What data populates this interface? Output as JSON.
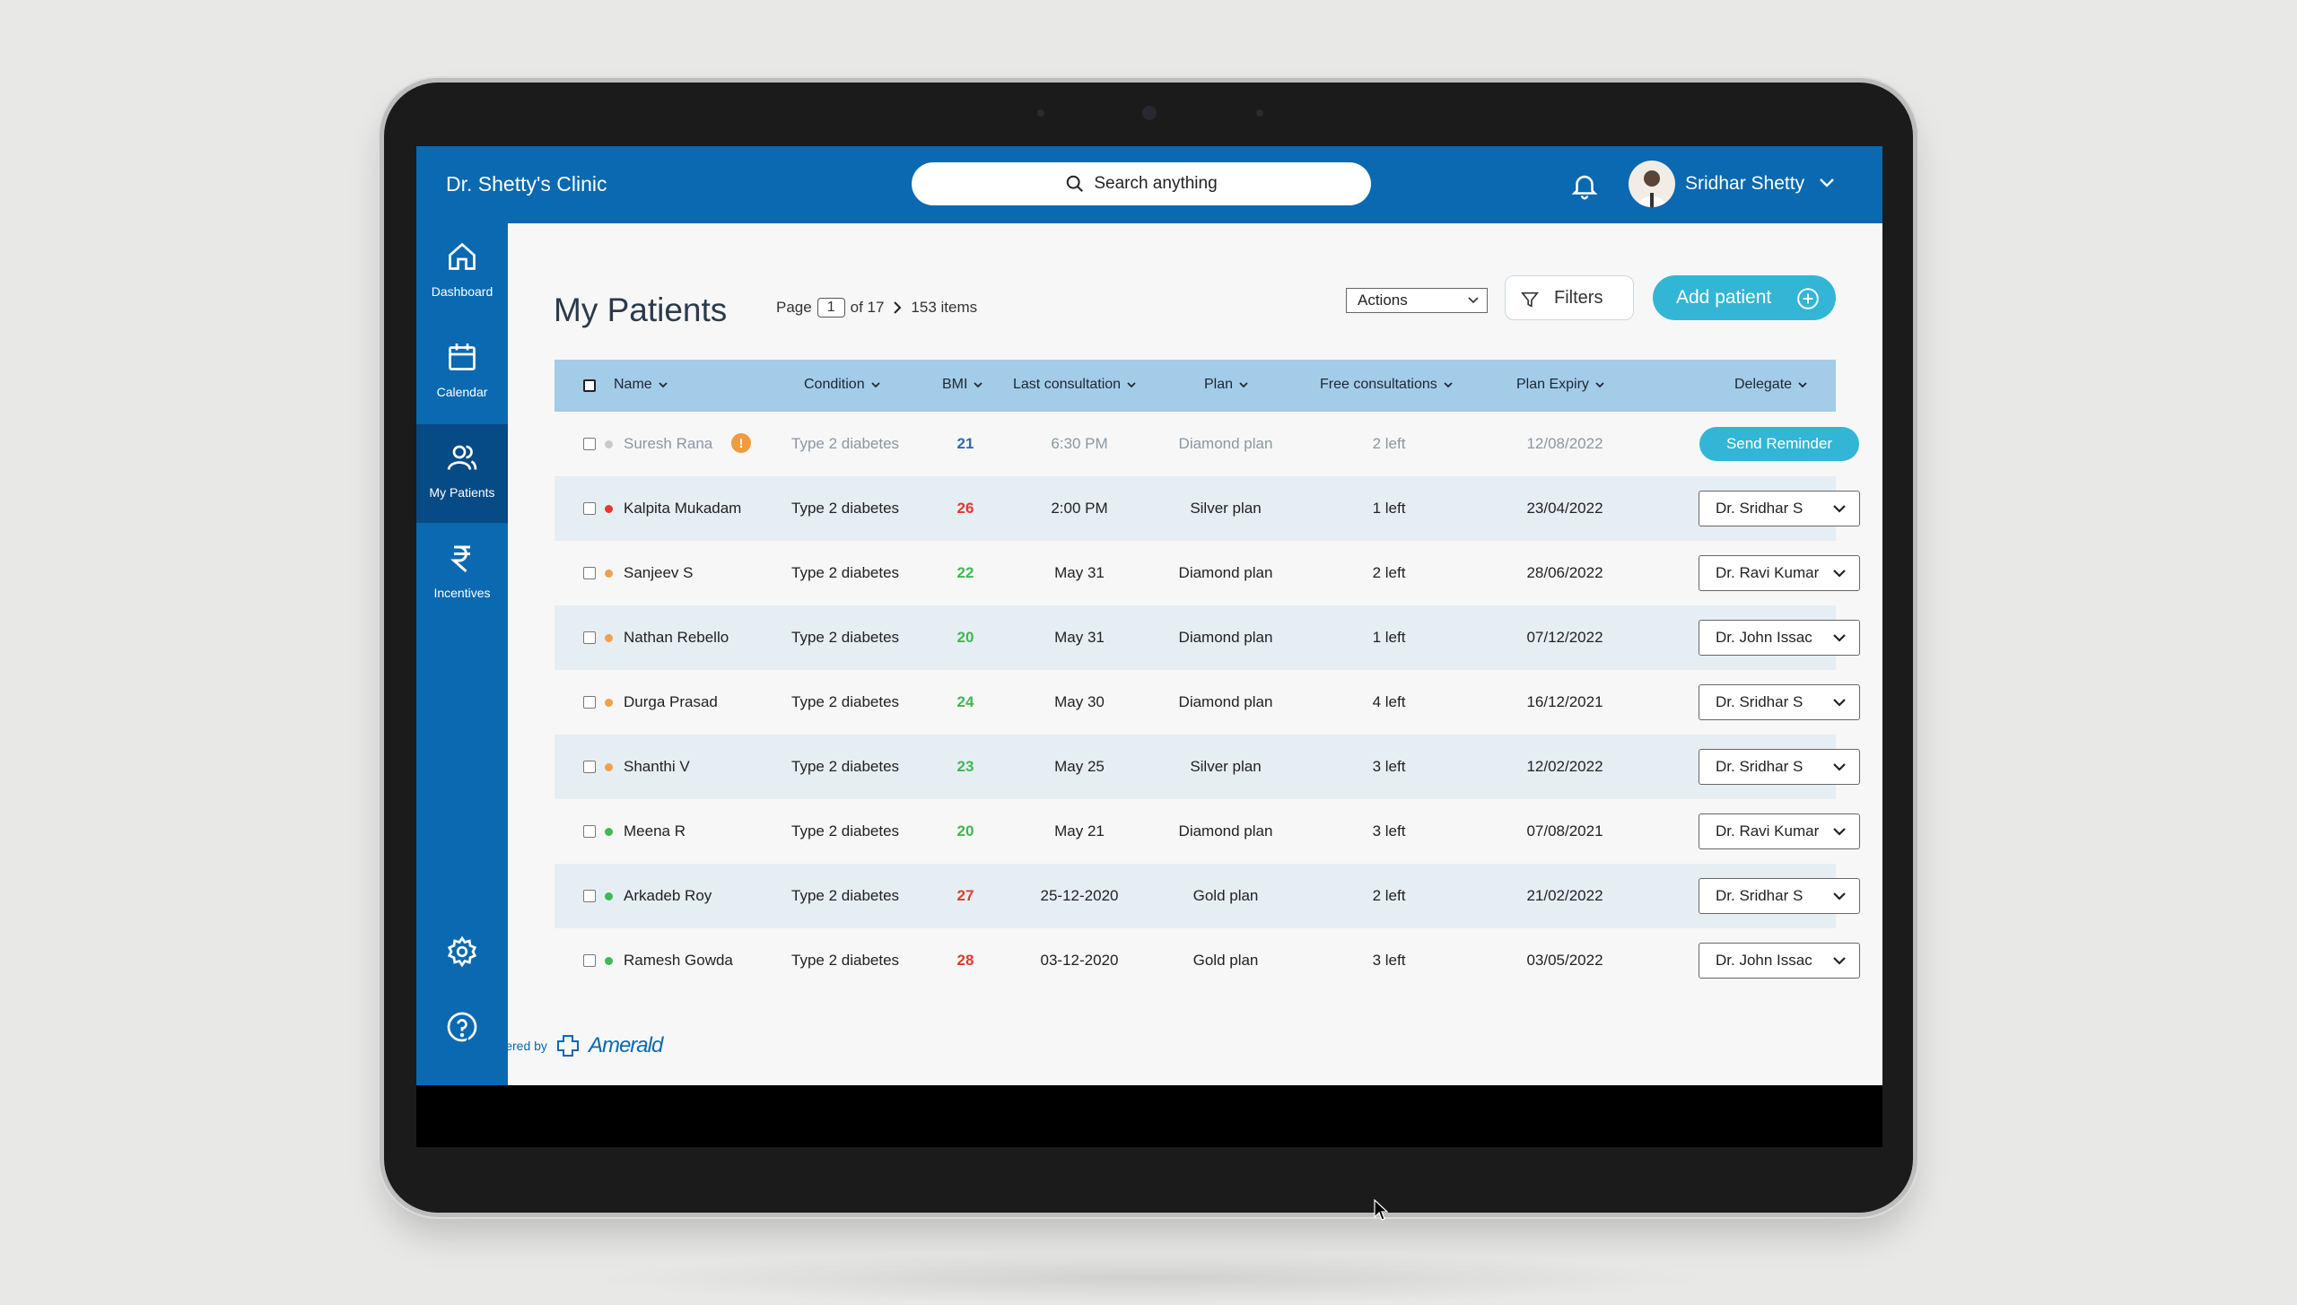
{
  "header": {
    "clinic_name": "Dr. Shetty's Clinic",
    "search_placeholder": "Search anything",
    "user_name": "Sridhar Shetty"
  },
  "sidebar": {
    "items": [
      {
        "label": "Dashboard",
        "icon": "home-icon"
      },
      {
        "label": "Calendar",
        "icon": "calendar-icon"
      },
      {
        "label": "My Patients",
        "icon": "users-icon",
        "active": true
      },
      {
        "label": "Incentives",
        "icon": "rupee-icon"
      }
    ],
    "bottom_icons": [
      "gear-icon",
      "help-icon"
    ]
  },
  "page": {
    "title": "My Patients",
    "page_label": "Page",
    "page_current": "1",
    "page_of": "of 17",
    "items_count": "153 items",
    "actions_label": "Actions",
    "filters_label": "Filters",
    "add_patient_label": "Add patient"
  },
  "table": {
    "columns": [
      "Name",
      "Condition",
      "BMI",
      "Last consultation",
      "Plan",
      "Free consultations",
      "Plan Expiry",
      "Delegate"
    ],
    "rows": [
      {
        "name": "Suresh Rana",
        "status": "gray",
        "warning": "!",
        "condition": "Type 2 diabetes",
        "bmi": "21",
        "bmi_color": "#2b6cb0",
        "last": "6:30 PM",
        "plan": "Diamond plan",
        "free": "2 left",
        "expiry": "12/08/2022",
        "delegate": "Send Reminder",
        "reminder": true
      },
      {
        "name": "Kalpita Mukadam",
        "status": "red",
        "condition": "Type 2 diabetes",
        "bmi": "26",
        "bmi_color": "#e5382d",
        "last": "2:00 PM",
        "plan": "Silver plan",
        "free": "1 left",
        "expiry": "23/04/2022",
        "delegate": "Dr. Sridhar S"
      },
      {
        "name": "Sanjeev S",
        "status": "orange",
        "condition": "Type 2 diabetes",
        "bmi": "22",
        "bmi_color": "#3fb950",
        "last": "May 31",
        "plan": "Diamond plan",
        "free": "2 left",
        "expiry": "28/06/2022",
        "delegate": "Dr. Ravi Kumar"
      },
      {
        "name": "Nathan Rebello",
        "status": "orange",
        "condition": "Type 2 diabetes",
        "bmi": "20",
        "bmi_color": "#3fb950",
        "last": "May 31",
        "plan": "Diamond plan",
        "free": "1 left",
        "expiry": "07/12/2022",
        "delegate": "Dr. John Issac"
      },
      {
        "name": "Durga Prasad",
        "status": "orange",
        "condition": "Type 2 diabetes",
        "bmi": "24",
        "bmi_color": "#3fb950",
        "last": "May 30",
        "plan": "Diamond plan",
        "free": "4 left",
        "expiry": "16/12/2021",
        "delegate": "Dr. Sridhar S"
      },
      {
        "name": "Shanthi V",
        "status": "orange",
        "condition": "Type 2 diabetes",
        "bmi": "23",
        "bmi_color": "#3fb950",
        "last": "May 25",
        "plan": "Silver plan",
        "free": "3 left",
        "expiry": "12/02/2022",
        "delegate": "Dr. Sridhar S"
      },
      {
        "name": "Meena R",
        "status": "green",
        "condition": "Type 2 diabetes",
        "bmi": "20",
        "bmi_color": "#3fb950",
        "last": "May 21",
        "plan": "Diamond plan",
        "free": "3 left",
        "expiry": "07/08/2021",
        "delegate": "Dr. Ravi Kumar"
      },
      {
        "name": "Arkadeb Roy",
        "status": "green",
        "condition": "Type 2 diabetes",
        "bmi": "27",
        "bmi_color": "#e5382d",
        "last": "25-12-2020",
        "plan": "Gold plan",
        "free": "2 left",
        "expiry": "21/02/2022",
        "delegate": "Dr. Sridhar S"
      },
      {
        "name": "Ramesh Gowda",
        "status": "green",
        "condition": "Type 2 diabetes",
        "bmi": "28",
        "bmi_color": "#e5382d",
        "last": "03-12-2020",
        "plan": "Gold plan",
        "free": "3 left",
        "expiry": "03/05/2022",
        "delegate": "Dr. John Issac"
      }
    ]
  },
  "footer": {
    "powered_by": "Powered by",
    "brand": "Amerald"
  },
  "colors": {
    "primary": "#0a69b0",
    "accent": "#33b6d5",
    "header_row": "#a3cce9",
    "status_red": "#e5382d",
    "status_orange": "#f0a04b",
    "status_green": "#3fb950",
    "status_gray": "#c9c9c9"
  }
}
